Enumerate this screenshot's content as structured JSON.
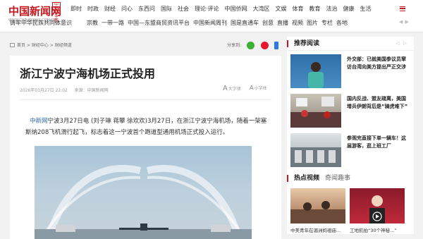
{
  "header": {
    "logo_text": "中国新闻网",
    "logo_sub": "WWW.CHINANEWS.COM.CN",
    "logo_badge": "中新社主办",
    "nav_row1": [
      "即时",
      "时政",
      "财经",
      "问心",
      "东西问",
      "国际",
      "社会",
      "理论·评论",
      "中国侨网",
      "大湾区",
      "文娱",
      "体育",
      "教育",
      "法治",
      "健康",
      "生活"
    ],
    "nav_row2_left": "铸牢中华民族共同体意识",
    "nav_row2": [
      "宗教",
      "一带一路",
      "中国—东盟商贸资讯平台",
      "中国新闻周刊",
      "国是直通车",
      "创意",
      "直播",
      "视频",
      "图片",
      "专栏",
      "各地"
    ]
  },
  "breadcrumb": {
    "items": [
      "首页",
      "财经中心",
      "财经频道"
    ],
    "share_label": "分享到:"
  },
  "article": {
    "title": "浙江宁波宁海机场正式投用",
    "date": "2026年03月27日 22:02",
    "source": "来源：中国新闻网",
    "font_large": "大字体",
    "font_small": "小字体",
    "lead_link": "中新网",
    "lead_text": "宁波3月27日电 (刘子琳 蒋攀 徐欢欢)3月27日，在浙江宁波宁海机场，随着一架塞斯纳208飞机滑行起飞，标志着这一宁波首个跑道型通用机场正式投入运行。"
  },
  "sidebar": {
    "recommend_title": "推荐阅读",
    "recommend": [
      {
        "text": "外交部：已就美国参议员窜访台湾向美方提出严正交涉"
      },
      {
        "text": "国内反战、盟友疏离，美国增兵伊朗背后是“骑虎难下”"
      },
      {
        "text": "参观完直接下单一辆车！这届游客，逛上班工厂"
      }
    ],
    "hot_title": "热点视频",
    "hot_tab2": "奇闻趣事",
    "videos": [
      {
        "caption": "中美青年在湄洲妈祖庙..."
      },
      {
        "caption": "工地航拍“30个神秘...”"
      }
    ]
  },
  "colors": {
    "brand": "#c8161e",
    "link": "#2a6bb6"
  }
}
